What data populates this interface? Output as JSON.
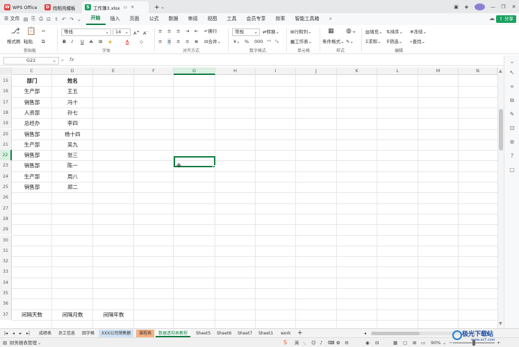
{
  "tabs": [
    {
      "label": "WPS Office",
      "logo": "W"
    },
    {
      "label": "找稻壳模板",
      "logo": "D"
    },
    {
      "label": "工作簿3.xlsx",
      "logo": "S"
    }
  ],
  "menu": {
    "file": "文件",
    "items": [
      "开始",
      "插入",
      "页面",
      "公式",
      "数据",
      "审阅",
      "视图",
      "工具",
      "会员专享",
      "效率",
      "智能工具箱"
    ],
    "share": "分享"
  },
  "ribbon": {
    "format_painter": "格式刷",
    "paste": "粘贴",
    "clipboard": "剪贴板",
    "font_name": "等线",
    "font_size": "14",
    "font": "字体",
    "wrap": "换行",
    "merge": "合并",
    "alignment": "对齐方式",
    "number_format": "常规",
    "convert": "转换",
    "number": "数字格式",
    "row_col": "行和列",
    "worksheet": "工作表",
    "cell": "单元格",
    "cond_format": "条件格式",
    "style": "样式",
    "fill": "填充",
    "sort": "排序",
    "freeze": "冻结",
    "sum": "求和",
    "filter": "筛选",
    "find": "查找",
    "edit": "编辑"
  },
  "formula_bar": {
    "name_box": "G22",
    "fx": "fx"
  },
  "columns": [
    "C",
    "D",
    "E",
    "F",
    "G",
    "H",
    "I",
    "J",
    "K",
    "L",
    "M",
    "N"
  ],
  "rows": [
    "15",
    "16",
    "17",
    "18",
    "19",
    "20",
    "21",
    "22",
    "23",
    "24",
    "25",
    "26",
    "27",
    "28",
    "29",
    "30",
    "31",
    "32",
    "33",
    "34",
    "35",
    "36",
    "37"
  ],
  "table": {
    "header": [
      "部门",
      "姓名"
    ],
    "rows": [
      [
        "生产部",
        "王五"
      ],
      [
        "销售部",
        "冯十"
      ],
      [
        "人资部",
        "孙七"
      ],
      [
        "总经办",
        "李四"
      ],
      [
        "销售部",
        "杨十四"
      ],
      [
        "生产部",
        "吴九"
      ],
      [
        "销售部",
        "张三"
      ],
      [
        "销售部",
        "陈一"
      ],
      [
        "生产部",
        "周八"
      ],
      [
        "销售部",
        "郑二"
      ]
    ]
  },
  "partial_row": [
    "间隔天数",
    "间隔月数",
    "间隔年数"
  ],
  "sheets": [
    {
      "label": "成绩表",
      "color": ""
    },
    {
      "label": "员工信息",
      "color": ""
    },
    {
      "label": "田字格",
      "color": ""
    },
    {
      "label": "XXX公司销售额",
      "color": "#cfe2f3"
    },
    {
      "label": "课程表",
      "color": "#f4b183"
    },
    {
      "label": "数据透视表教程",
      "color": "",
      "active": true
    },
    {
      "label": "Sheet5",
      "color": ""
    },
    {
      "label": "Sheet6",
      "color": ""
    },
    {
      "label": "Sheet7",
      "color": ""
    },
    {
      "label": "Sheet1",
      "color": ""
    },
    {
      "label": "work",
      "color": ""
    }
  ],
  "status": {
    "left": "财务报表管理",
    "zoom": "90%"
  },
  "watermark": {
    "text": "极光下载站",
    "sub": "www.xz7.com"
  }
}
